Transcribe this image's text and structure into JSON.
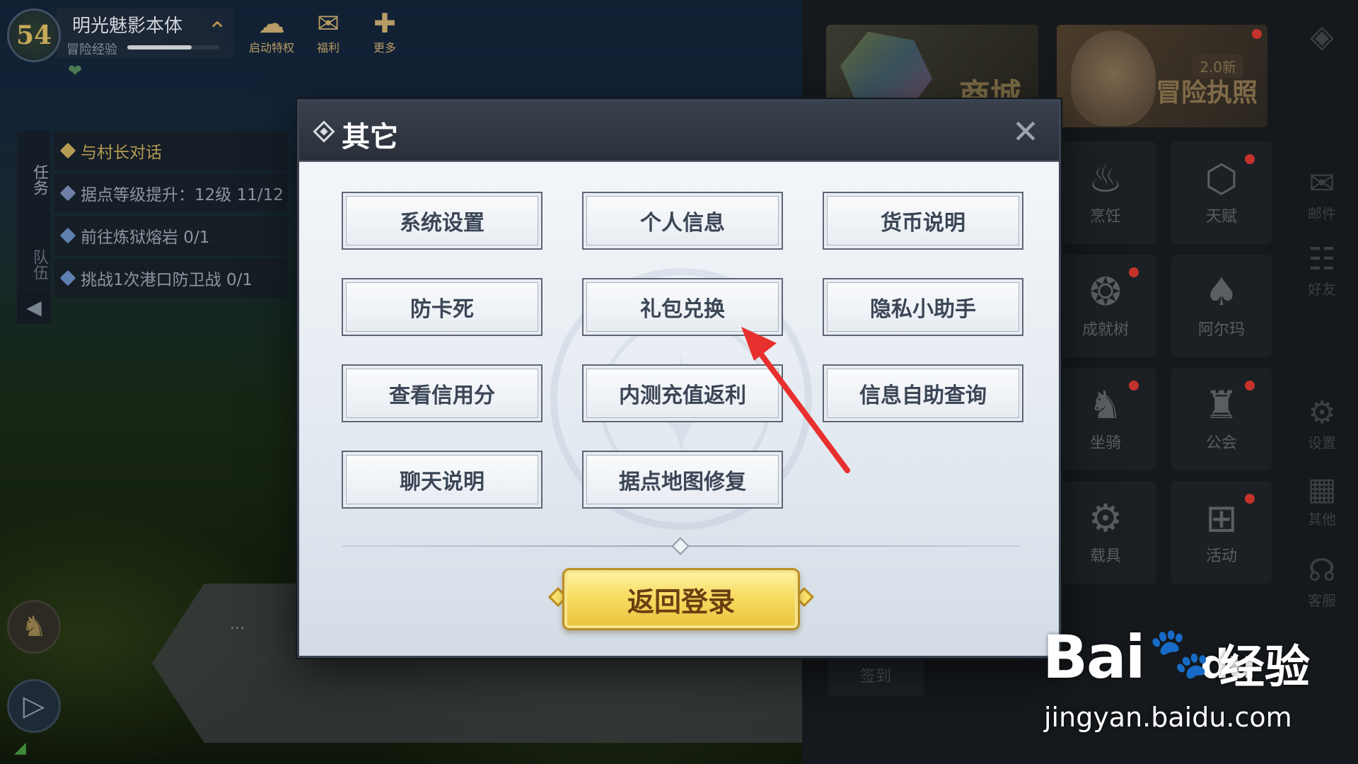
{
  "hud": {
    "level": "54",
    "player_name": "明光魅影本体",
    "xp_label": "冒险经验",
    "xp_progress": 0.7,
    "buttons": [
      {
        "label": "启动特权",
        "icon": "wechat-icon"
      },
      {
        "label": "福利",
        "icon": "gift-icon"
      },
      {
        "label": "更多",
        "icon": "more-grid-icon"
      }
    ]
  },
  "quests": {
    "tab_tasks": "任务",
    "tab_team": "队伍",
    "items": [
      {
        "text": "与村长对话",
        "color": "#b59c52",
        "active": true
      },
      {
        "text": "据点等级提升：12级 11/12",
        "color": "#6f7fa8",
        "active": false
      },
      {
        "text": "前往炼狱熔岩 0/1",
        "color": "#5e7fb0",
        "active": false
      },
      {
        "text": "挑战1次港口防卫战 0/1",
        "color": "#5e7fb0",
        "active": false
      }
    ]
  },
  "right_panel": {
    "banner_shop": "商城",
    "banner_license": "冒险执照",
    "banner_license_tag": "2.0新",
    "tiles": [
      {
        "label": "烹饪",
        "icon": "cooking-pot-icon"
      },
      {
        "label": "天赋",
        "icon": "talent-icon"
      },
      {
        "label": "成就树",
        "icon": "achievement-icon"
      },
      {
        "label": "阿尔玛",
        "icon": "flame-spirit-icon"
      },
      {
        "label": "坐骑",
        "icon": "horse-icon"
      },
      {
        "label": "公会",
        "icon": "castle-icon"
      },
      {
        "label": "载具",
        "icon": "motorcycle-icon"
      },
      {
        "label": "活动",
        "icon": "gift-box-icon"
      }
    ],
    "side_buttons": [
      {
        "label": "邮件",
        "icon": "mail-icon"
      },
      {
        "label": "好友",
        "icon": "friends-icon"
      },
      {
        "label": "设置",
        "icon": "gear-icon"
      },
      {
        "label": "其他",
        "icon": "other-icon"
      },
      {
        "label": "客服",
        "icon": "support-icon"
      }
    ],
    "sign_in": "签到"
  },
  "road_label": "...",
  "dialog": {
    "title": "其它",
    "buttons": [
      "系统设置",
      "个人信息",
      "货币说明",
      "防卡死",
      "礼包兑换",
      "隐私小助手",
      "查看信用分",
      "内测充值返利",
      "信息自助查询",
      "聊天说明",
      "据点地图修复"
    ],
    "return_button": "返回登录"
  },
  "watermark": {
    "brand": "Bai",
    "brand_suffix": "du",
    "jingyan": "经验",
    "url": "jingyan.baidu.com"
  },
  "colors": {
    "annotation_arrow": "#e8302e",
    "return_button": "#f5d65a",
    "dialog_header": "#2f3540"
  }
}
